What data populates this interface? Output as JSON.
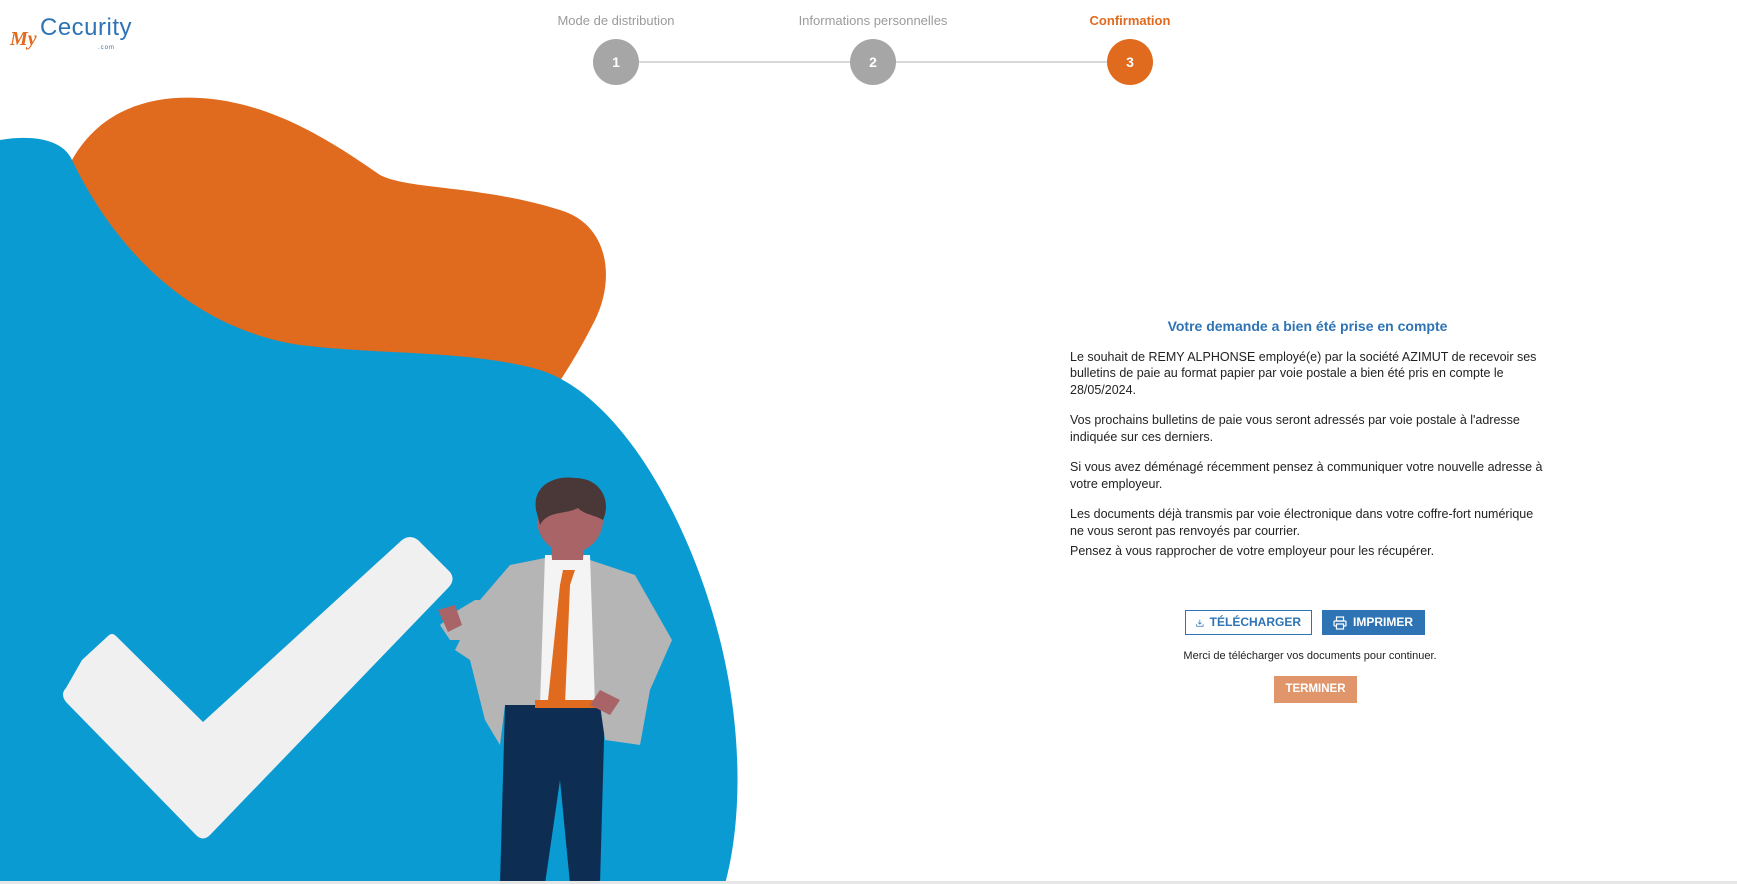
{
  "logo": {
    "my": "My",
    "brand": "Cecurity",
    "domain": ".com"
  },
  "steps": [
    {
      "label": "Mode de distribution",
      "number": "1",
      "state": "done"
    },
    {
      "label": "Informations personnelles",
      "number": "2",
      "state": "done"
    },
    {
      "label": "Confirmation",
      "number": "3",
      "state": "active"
    }
  ],
  "confirmation": {
    "title": "Votre demande a bien été prise en compte",
    "p1": "Le souhait de REMY ALPHONSE employé(e) par la société AZIMUT de recevoir ses bulletins de paie au format papier par voie postale a bien été pris en compte le 28/05/2024.",
    "p2": "Vos prochains bulletins de paie vous seront adressés par voie postale à l'adresse indiquée sur ces derniers.",
    "p3": "Si vous avez déménagé récemment pensez à communiquer votre nouvelle adresse à votre employeur.",
    "p4": "Les documents déjà transmis par voie électronique dans votre coffre-fort numérique ne vous seront pas renvoyés par courrier.",
    "p5": "Pensez à vous rapprocher de votre employeur pour les récupérer."
  },
  "actions": {
    "download_label": "TÉLÉCHARGER",
    "print_label": "IMPRIMER",
    "note": "Merci de télécharger vos documents pour continuer.",
    "finish_label": "TERMINER"
  },
  "colors": {
    "brand_blue": "#2e74b5",
    "accent_orange": "#e06a1e",
    "step_gray": "#a6a6a6",
    "blob_blue": "#0a9bd3",
    "disabled_orange": "#e0956a"
  },
  "icons": {
    "download": "download-icon",
    "print": "printer-icon"
  }
}
